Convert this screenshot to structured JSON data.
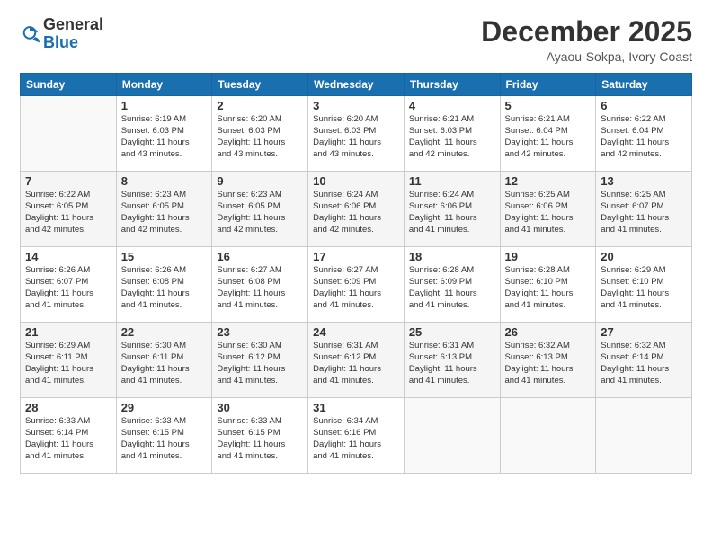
{
  "header": {
    "logo_general": "General",
    "logo_blue": "Blue",
    "month_title": "December 2025",
    "location": "Ayaou-Sokpa, Ivory Coast"
  },
  "days_of_week": [
    "Sunday",
    "Monday",
    "Tuesday",
    "Wednesday",
    "Thursday",
    "Friday",
    "Saturday"
  ],
  "weeks": [
    [
      {
        "day": "",
        "info": ""
      },
      {
        "day": "1",
        "info": "Sunrise: 6:19 AM\nSunset: 6:03 PM\nDaylight: 11 hours\nand 43 minutes."
      },
      {
        "day": "2",
        "info": "Sunrise: 6:20 AM\nSunset: 6:03 PM\nDaylight: 11 hours\nand 43 minutes."
      },
      {
        "day": "3",
        "info": "Sunrise: 6:20 AM\nSunset: 6:03 PM\nDaylight: 11 hours\nand 43 minutes."
      },
      {
        "day": "4",
        "info": "Sunrise: 6:21 AM\nSunset: 6:03 PM\nDaylight: 11 hours\nand 42 minutes."
      },
      {
        "day": "5",
        "info": "Sunrise: 6:21 AM\nSunset: 6:04 PM\nDaylight: 11 hours\nand 42 minutes."
      },
      {
        "day": "6",
        "info": "Sunrise: 6:22 AM\nSunset: 6:04 PM\nDaylight: 11 hours\nand 42 minutes."
      }
    ],
    [
      {
        "day": "7",
        "info": "Sunrise: 6:22 AM\nSunset: 6:05 PM\nDaylight: 11 hours\nand 42 minutes."
      },
      {
        "day": "8",
        "info": "Sunrise: 6:23 AM\nSunset: 6:05 PM\nDaylight: 11 hours\nand 42 minutes."
      },
      {
        "day": "9",
        "info": "Sunrise: 6:23 AM\nSunset: 6:05 PM\nDaylight: 11 hours\nand 42 minutes."
      },
      {
        "day": "10",
        "info": "Sunrise: 6:24 AM\nSunset: 6:06 PM\nDaylight: 11 hours\nand 42 minutes."
      },
      {
        "day": "11",
        "info": "Sunrise: 6:24 AM\nSunset: 6:06 PM\nDaylight: 11 hours\nand 41 minutes."
      },
      {
        "day": "12",
        "info": "Sunrise: 6:25 AM\nSunset: 6:06 PM\nDaylight: 11 hours\nand 41 minutes."
      },
      {
        "day": "13",
        "info": "Sunrise: 6:25 AM\nSunset: 6:07 PM\nDaylight: 11 hours\nand 41 minutes."
      }
    ],
    [
      {
        "day": "14",
        "info": "Sunrise: 6:26 AM\nSunset: 6:07 PM\nDaylight: 11 hours\nand 41 minutes."
      },
      {
        "day": "15",
        "info": "Sunrise: 6:26 AM\nSunset: 6:08 PM\nDaylight: 11 hours\nand 41 minutes."
      },
      {
        "day": "16",
        "info": "Sunrise: 6:27 AM\nSunset: 6:08 PM\nDaylight: 11 hours\nand 41 minutes."
      },
      {
        "day": "17",
        "info": "Sunrise: 6:27 AM\nSunset: 6:09 PM\nDaylight: 11 hours\nand 41 minutes."
      },
      {
        "day": "18",
        "info": "Sunrise: 6:28 AM\nSunset: 6:09 PM\nDaylight: 11 hours\nand 41 minutes."
      },
      {
        "day": "19",
        "info": "Sunrise: 6:28 AM\nSunset: 6:10 PM\nDaylight: 11 hours\nand 41 minutes."
      },
      {
        "day": "20",
        "info": "Sunrise: 6:29 AM\nSunset: 6:10 PM\nDaylight: 11 hours\nand 41 minutes."
      }
    ],
    [
      {
        "day": "21",
        "info": "Sunrise: 6:29 AM\nSunset: 6:11 PM\nDaylight: 11 hours\nand 41 minutes."
      },
      {
        "day": "22",
        "info": "Sunrise: 6:30 AM\nSunset: 6:11 PM\nDaylight: 11 hours\nand 41 minutes."
      },
      {
        "day": "23",
        "info": "Sunrise: 6:30 AM\nSunset: 6:12 PM\nDaylight: 11 hours\nand 41 minutes."
      },
      {
        "day": "24",
        "info": "Sunrise: 6:31 AM\nSunset: 6:12 PM\nDaylight: 11 hours\nand 41 minutes."
      },
      {
        "day": "25",
        "info": "Sunrise: 6:31 AM\nSunset: 6:13 PM\nDaylight: 11 hours\nand 41 minutes."
      },
      {
        "day": "26",
        "info": "Sunrise: 6:32 AM\nSunset: 6:13 PM\nDaylight: 11 hours\nand 41 minutes."
      },
      {
        "day": "27",
        "info": "Sunrise: 6:32 AM\nSunset: 6:14 PM\nDaylight: 11 hours\nand 41 minutes."
      }
    ],
    [
      {
        "day": "28",
        "info": "Sunrise: 6:33 AM\nSunset: 6:14 PM\nDaylight: 11 hours\nand 41 minutes."
      },
      {
        "day": "29",
        "info": "Sunrise: 6:33 AM\nSunset: 6:15 PM\nDaylight: 11 hours\nand 41 minutes."
      },
      {
        "day": "30",
        "info": "Sunrise: 6:33 AM\nSunset: 6:15 PM\nDaylight: 11 hours\nand 41 minutes."
      },
      {
        "day": "31",
        "info": "Sunrise: 6:34 AM\nSunset: 6:16 PM\nDaylight: 11 hours\nand 41 minutes."
      },
      {
        "day": "",
        "info": ""
      },
      {
        "day": "",
        "info": ""
      },
      {
        "day": "",
        "info": ""
      }
    ]
  ]
}
